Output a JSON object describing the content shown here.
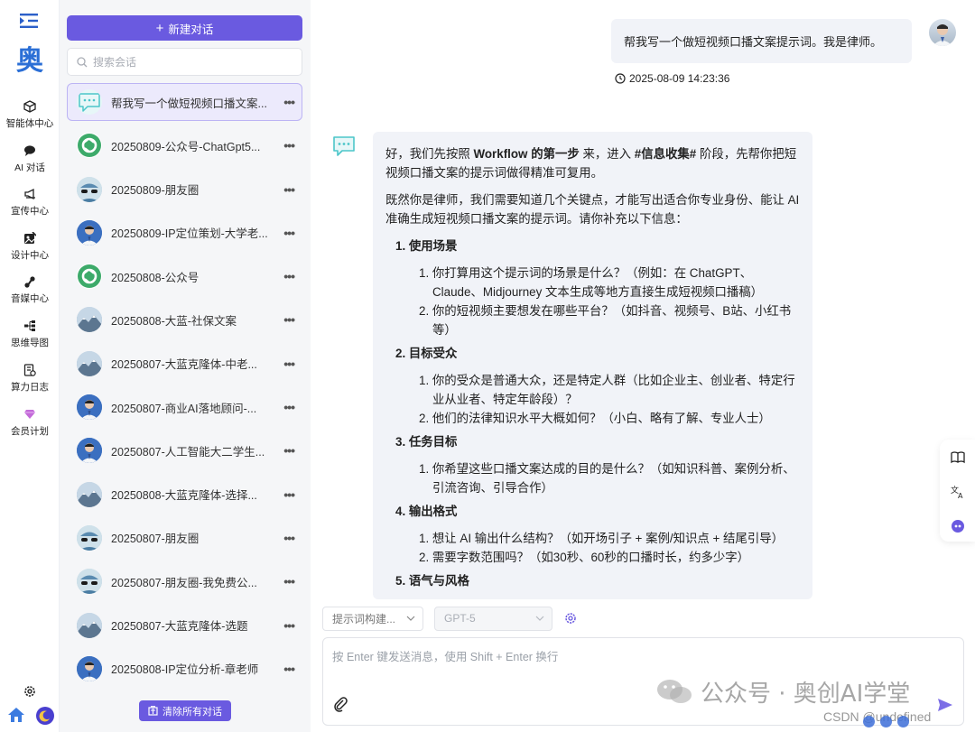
{
  "rail": {
    "logo_char": "奥",
    "items": [
      {
        "label": "智能体中心",
        "icon": "cube-icon"
      },
      {
        "label": "AI 对话",
        "icon": "chat-bubble-icon"
      },
      {
        "label": "宣传中心",
        "icon": "megaphone-icon"
      },
      {
        "label": "设计中心",
        "icon": "design-image-icon"
      },
      {
        "label": "音媒中心",
        "icon": "music-note-icon"
      },
      {
        "label": "思维导图",
        "icon": "mindmap-icon"
      },
      {
        "label": "算力日志",
        "icon": "log-document-icon"
      },
      {
        "label": "会员计划",
        "icon": "diamond-icon"
      }
    ]
  },
  "sidebar": {
    "new_chat_label": "新建对话",
    "search_placeholder": "搜索会话",
    "clear_all_label": "清除所有对话",
    "conversations": [
      {
        "title": "帮我写一个做短视频口播文案...",
        "avatar": "bot",
        "active": true
      },
      {
        "title": "20250809-公众号-ChatGpt5...",
        "avatar": "openai"
      },
      {
        "title": "20250809-朋友圈",
        "avatar": "cap"
      },
      {
        "title": "20250809-IP定位策划-大学老...",
        "avatar": "man"
      },
      {
        "title": "20250808-公众号",
        "avatar": "openai"
      },
      {
        "title": "20250808-大蓝-社保文案",
        "avatar": "mount"
      },
      {
        "title": "20250807-大蓝克隆体-中老...",
        "avatar": "mount"
      },
      {
        "title": "20250807-商业AI落地顾问-...",
        "avatar": "man"
      },
      {
        "title": "20250807-人工智能大二学生...",
        "avatar": "man"
      },
      {
        "title": "20250808-大蓝克隆体-选择...",
        "avatar": "mount"
      },
      {
        "title": "20250807-朋友圈",
        "avatar": "cap"
      },
      {
        "title": "20250807-朋友圈-我免费公...",
        "avatar": "cap"
      },
      {
        "title": "20250807-大蓝克隆体-选题",
        "avatar": "mount"
      },
      {
        "title": "20250808-IP定位分析-章老师",
        "avatar": "man"
      }
    ],
    "more_glyph": "•••"
  },
  "chat": {
    "user_message": "帮我写一个做短视频口播文案提示词。我是律师。",
    "timestamp": "2025-08-09 14:23:36",
    "bot": {
      "intro_pre": "好，我们先按照 ",
      "intro_bold": "Workflow 的第一步",
      "intro_mid": " 来，进入 ",
      "intro_bold2": "#信息收集#",
      "intro_post": " 阶段，先帮你把短视频口播文案的提示词做得精准可复用。",
      "para2": "既然你是律师，我们需要知道几个关键点，才能写出适合你专业身份、能让 AI 准确生成短视频口播文案的提示词。请你补充以下信息：",
      "sections": [
        {
          "title": "1. 使用场景",
          "items": [
            "1. 你打算用这个提示词的场景是什么？（例如：在 ChatGPT、Claude、Midjourney 文本生成等地方直接生成短视频口播稿）",
            "2. 你的短视频主要想发在哪些平台？（如抖音、视频号、B站、小红书等）"
          ]
        },
        {
          "title": "2. 目标受众",
          "items": [
            "1. 你的受众是普通大众，还是特定人群（比如企业主、创业者、特定行业从业者、特定年龄段）？",
            "2. 他们的法律知识水平大概如何？（小白、略有了解、专业人士）"
          ]
        },
        {
          "title": "3. 任务目标",
          "items": [
            "1. 你希望这些口播文案达成的目的是什么？（如知识科普、案例分析、引流咨询、引导合作）"
          ]
        },
        {
          "title": "4. 输出格式",
          "items": [
            "1. 想让 AI 输出什么结构？（如开场引子 + 案例/知识点 + 结尾引导）",
            "2. 需要字数范围吗？（如30秒、60秒的口播时长，约多少字）"
          ]
        },
        {
          "title": "5. 语气与风格",
          "items": []
        }
      ]
    }
  },
  "composer": {
    "prompt_select": "提示词构建...",
    "model_select": "GPT-5",
    "placeholder": "按 Enter 键发送消息，使用 Shift + Enter 换行"
  },
  "watermark": {
    "main": "公众号 · 奥创AI学堂",
    "sub": "CSDN @undefined"
  }
}
